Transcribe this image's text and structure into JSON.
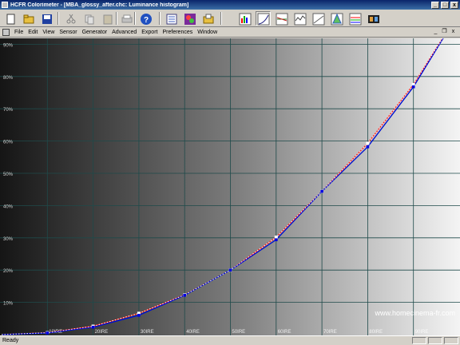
{
  "window": {
    "title": "HCFR Colorimeter - [MBA_glossy_after.chc: Luminance histogram]",
    "controls": [
      "_",
      "□",
      "x"
    ]
  },
  "toolbar": {
    "buttons": [
      {
        "name": "new-icon"
      },
      {
        "name": "open-icon"
      },
      {
        "name": "save-icon"
      },
      {
        "name": "cut-icon"
      },
      {
        "name": "copy-icon"
      },
      {
        "name": "paste-icon"
      },
      {
        "name": "print-icon"
      },
      {
        "name": "help-icon"
      },
      {
        "name": "measures-view-icon"
      },
      {
        "name": "gamut-view-icon"
      },
      {
        "name": "open-folder-view-icon"
      },
      {
        "name": "rgb-histogram-icon"
      },
      {
        "name": "luminance-histogram-icon",
        "pressed": true
      },
      {
        "name": "gamma-histogram-icon"
      },
      {
        "name": "color-temperature-icon"
      },
      {
        "name": "delta-e-icon"
      },
      {
        "name": "cie-chart-icon"
      },
      {
        "name": "multi-curve-icon"
      },
      {
        "name": "film-icon"
      }
    ]
  },
  "menu": {
    "items": [
      "File",
      "Edit",
      "View",
      "Sensor",
      "Generator",
      "Advanced",
      "Export",
      "Preferences",
      "Window"
    ],
    "mdi_controls": [
      "_",
      "❐",
      "x"
    ]
  },
  "chart_data": {
    "type": "line",
    "x": [
      0,
      10,
      20,
      30,
      40,
      50,
      60,
      70,
      80,
      90,
      100
    ],
    "x_tick_labels": [
      "10IRE",
      "20IRE",
      "30IRE",
      "40IRE",
      "50IRE",
      "60IRE",
      "70IRE",
      "80IRE",
      "90IRE"
    ],
    "y_tick_labels": [
      "10%",
      "20%",
      "30%",
      "40%",
      "50%",
      "60%",
      "70%",
      "80%",
      "90%"
    ],
    "ylim": [
      0,
      100
    ],
    "xlim": [
      0,
      100
    ],
    "grid": true,
    "series": [
      {
        "values": [
          0,
          0.6,
          2.6,
          6.6,
          12.3,
          20.0,
          30.2,
          44.4,
          59.3,
          77.5,
          100
        ],
        "color": "#ff1a1a",
        "style": "solid"
      },
      {
        "values": [
          0,
          0.6,
          2.6,
          6.6,
          12.3,
          20.0,
          30.2,
          44.4,
          59.3,
          77.5,
          100
        ],
        "color": "#ffffff",
        "style": "dotted"
      },
      {
        "values": [
          0,
          0.5,
          2.3,
          6.0,
          12.2,
          20.0,
          29.4,
          44.4,
          58.2,
          76.8,
          100
        ],
        "color": "#0000e0",
        "style": "solid",
        "markers": true
      },
      {
        "values": [
          0,
          0.5,
          2.3,
          6.0,
          12.2,
          20.0,
          29.4,
          44.4,
          58.2,
          76.8,
          100
        ],
        "color": "#008a4a",
        "style": "solid"
      }
    ],
    "watermark": "www.homecinema-fr.com"
  },
  "status": {
    "text": "Ready"
  }
}
